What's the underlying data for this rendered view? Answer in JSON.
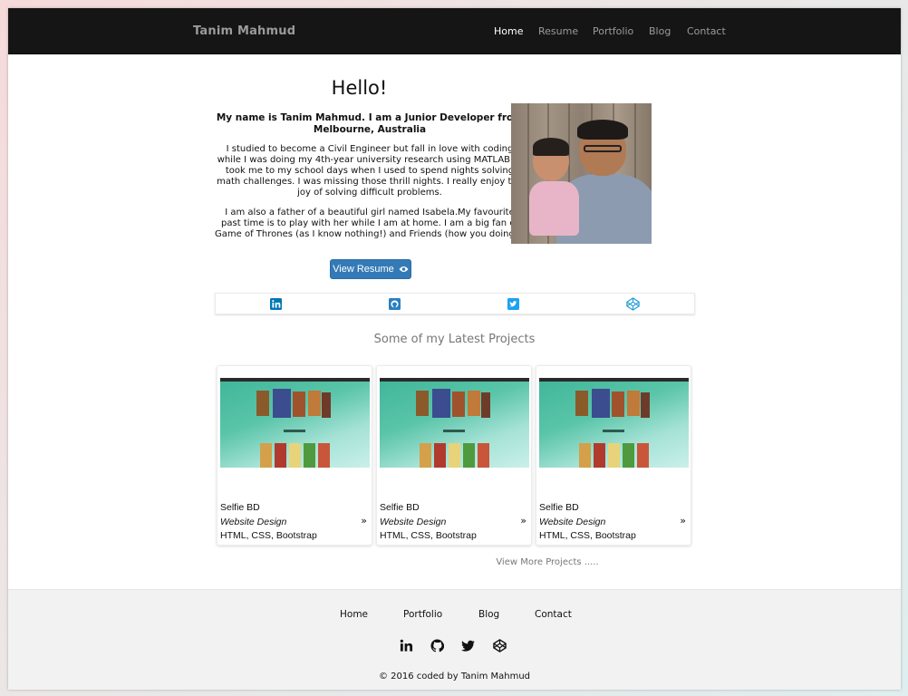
{
  "navbar": {
    "brand": "Tanim Mahmud",
    "items": [
      {
        "label": "Home",
        "active": true
      },
      {
        "label": "Resume",
        "active": false
      },
      {
        "label": "Portfolio",
        "active": false
      },
      {
        "label": "Blog",
        "active": false
      },
      {
        "label": "Contact",
        "active": false
      }
    ]
  },
  "intro": {
    "greeting": "Hello!",
    "lead": "My name is Tanim Mahmud. I am a Junior Developer from Melbourne, Australia",
    "paragraph1": "I studied to become a Civil Engineer but fall in love with coding while I was doing my 4th-year university research using MATLAB. It took me to my school days when I used to spend nights solving math challenges. I was missing those thrill nights. I really enjoy the joy of solving difficult problems.",
    "paragraph2": "I am also a father of a beautiful girl named Isabela.My favourite past time is to play with her while I am at home. I am a big fan of Game of Thrones (as I know nothing!) and Friends (how you doing!).",
    "resume_button": "View Resume",
    "resume_icon": "eye-icon"
  },
  "social": {
    "icons": [
      "linkedin-icon",
      "github-icon",
      "twitter-icon",
      "codepen-icon"
    ],
    "colors": {
      "linkedin": "#0077b5",
      "github": "#2a7fc0",
      "twitter": "#1da1f2",
      "codepen": "#1e9bd7"
    }
  },
  "projects": {
    "title": "Some of my Latest Projects",
    "items": [
      {
        "title": "Selfie BD",
        "type": "Website Design",
        "tech": "HTML, CSS, Bootstrap",
        "arrow": "»"
      },
      {
        "title": "Selfie BD",
        "type": "Website Design",
        "tech": "HTML, CSS, Bootstrap",
        "arrow": "»"
      },
      {
        "title": "Selfie BD",
        "type": "Website Design",
        "tech": "HTML, CSS, Bootstrap",
        "arrow": "»"
      }
    ],
    "view_more": "View More Projects ....."
  },
  "footer": {
    "nav": [
      "Home",
      "Portfolio",
      "Blog",
      "Contact"
    ],
    "icons": [
      "linkedin-icon",
      "github-icon",
      "twitter-icon",
      "codepen-icon"
    ],
    "copyright": "© 2016 coded by Tanim Mahmud"
  }
}
